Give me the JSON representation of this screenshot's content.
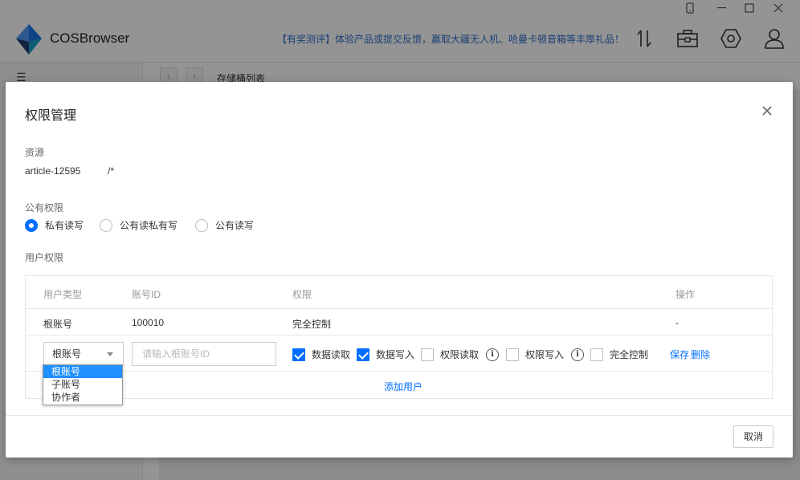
{
  "app": {
    "name": "COSBrowser",
    "promo": "【有奖测评】体验产品或提交反馈，赢取大疆无人机、哈曼卡顿音箱等丰厚礼品！",
    "breadcrumb": "存储桶列表"
  },
  "modal": {
    "title": "权限管理",
    "resource_label": "资源",
    "resource_name": "article-12595",
    "resource_path": "/*",
    "public_label": "公有权限",
    "public_options": [
      {
        "label": "私有读写",
        "checked": true
      },
      {
        "label": "公有读私有写",
        "checked": false
      },
      {
        "label": "公有读写",
        "checked": false
      }
    ],
    "user_label": "用户权限",
    "table": {
      "headers": {
        "user_type": "用户类型",
        "account_id": "账号ID",
        "permission": "权限",
        "action": "操作"
      },
      "row": {
        "user_type": "根账号",
        "account_id": "100010",
        "permission": "完全控制",
        "action": "-"
      },
      "edit_row": {
        "selected_type": "根账号",
        "input_placeholder": "请输入根账号ID",
        "perms": [
          {
            "label": "数据读取",
            "checked": true
          },
          {
            "label": "数据写入",
            "checked": true
          },
          {
            "label": "权限读取",
            "checked": false
          },
          {
            "label": "权限写入",
            "checked": false
          },
          {
            "label": "完全控制",
            "checked": false
          }
        ],
        "save": "保存",
        "delete": "删除"
      },
      "add_user": "添加用户"
    },
    "dropdown_options": [
      "根账号",
      "子账号",
      "协作者"
    ],
    "cancel": "取消"
  },
  "colors": {
    "accent": "#006eff",
    "link": "#006eff",
    "promo": "#2d6ec9"
  }
}
